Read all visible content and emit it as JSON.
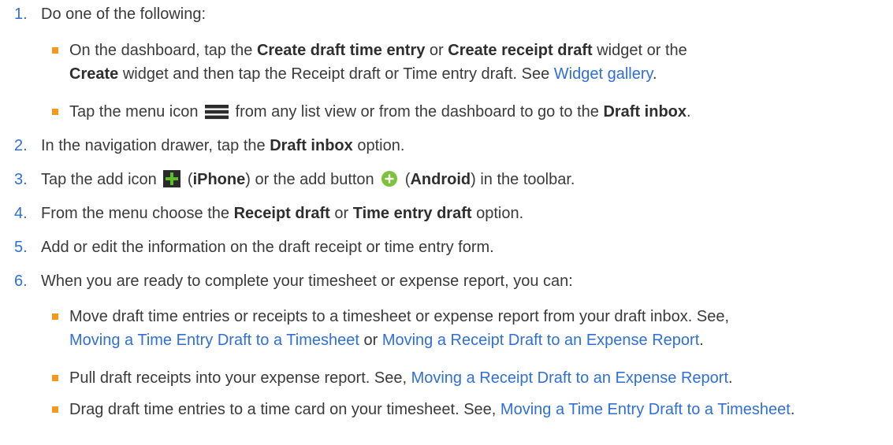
{
  "steps": [
    {
      "num": "1.",
      "text": "Do one of the following:"
    },
    {
      "num": "2.",
      "pre": "In the navigation drawer, tap the ",
      "bold": "Draft inbox",
      "post": " option."
    },
    {
      "num": "3.",
      "pre": "Tap the add icon ",
      "p1": " (",
      "iphone": "iPhone",
      "p2": ") or the add button ",
      "p3": " (",
      "android": "Android",
      "p4": ") in the toolbar."
    },
    {
      "num": "4.",
      "pre": "From the menu choose the ",
      "bold1": "Receipt draft",
      "mid": " or ",
      "bold2": "Time entry draft",
      "post": " option."
    },
    {
      "num": "5.",
      "text": "Add or edit the information on the draft receipt or time entry form."
    },
    {
      "num": "6.",
      "text": "When you are ready to complete your timesheet or expense report, you can:"
    }
  ],
  "step1_bullets": {
    "b1": {
      "t1": "On the dashboard, tap the ",
      "bold1": "Create draft time entry",
      "t2": " or ",
      "bold2": "Create receipt draft",
      "t3": " widget or the ",
      "bold3": "Create",
      "t4": " widget and then tap the Receipt draft or Time entry draft. See ",
      "link": "Widget gallery",
      "t5": "."
    },
    "b2": {
      "t1": "Tap the menu icon ",
      "t2": " from any list view or from the dashboard to go to the ",
      "bold": "Draft inbox",
      "t3": "."
    }
  },
  "step6_bullets": {
    "b1": {
      "t1": "Move draft time entries or receipts to a timesheet or expense report from your draft inbox. See, ",
      "link1": "Moving a Time Entry Draft to a Timesheet",
      "t2": " or ",
      "link2": "Moving a Receipt Draft to an Expense Report",
      "t3": "."
    },
    "b2": {
      "t1": "Pull draft receipts into your expense report. See, ",
      "link": "Moving a Receipt Draft to an Expense Report",
      "t2": "."
    },
    "b3": {
      "t1": "Drag draft time entries to a time card on your timesheet. See, ",
      "link": "Moving a Time Entry Draft to a Timesheet",
      "t2": "."
    }
  },
  "colors": {
    "text": "#3a3a3a",
    "link": "#2f6fd6",
    "bullet": "#f39a1e",
    "add_icon": "#4caf50",
    "menu_icon": "#2b2b2b"
  },
  "icons": [
    "menu-icon",
    "add-icon",
    "add-button-icon"
  ]
}
